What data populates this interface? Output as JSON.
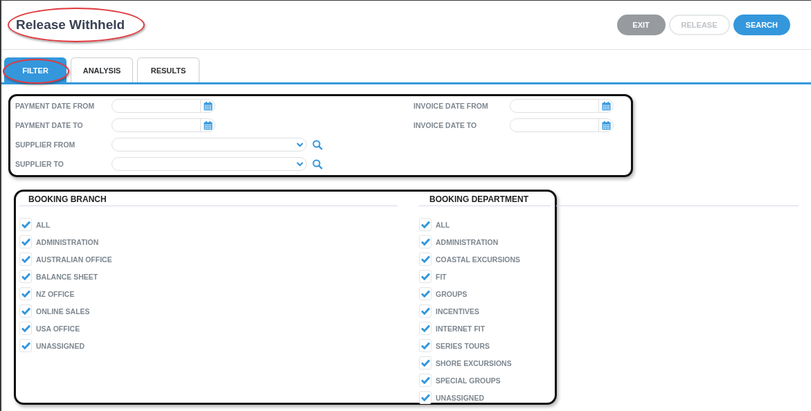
{
  "window": {
    "title": "Release Withheld"
  },
  "actions": [
    {
      "label": "EXIT",
      "kind": "secondary",
      "disabled": false
    },
    {
      "label": "RELEASE",
      "kind": "outline",
      "disabled": true
    },
    {
      "label": "SEARCH",
      "kind": "primary",
      "disabled": false
    }
  ],
  "tabs": [
    {
      "label": "FILTER",
      "selected": true
    },
    {
      "label": "ANALYSIS",
      "selected": false
    },
    {
      "label": "RESULTS",
      "selected": false
    }
  ],
  "filters_left": [
    {
      "label": "PAYMENT DATE FROM",
      "kind": "date"
    },
    {
      "label": "PAYMENT DATE TO",
      "kind": "date"
    },
    {
      "label": "SUPPLIER FROM",
      "kind": "select"
    },
    {
      "label": "SUPPLIER TO",
      "kind": "select"
    }
  ],
  "filters_right": [
    {
      "label": "INVOICE DATE FROM",
      "kind": "date"
    },
    {
      "label": "INVOICE DATE TO",
      "kind": "date"
    }
  ],
  "booking_branch": {
    "title": "BOOKING BRANCH",
    "items": [
      {
        "label": "ALL",
        "checked": true
      },
      {
        "label": "ADMINISTRATION",
        "checked": true
      },
      {
        "label": "AUSTRALIAN OFFICE",
        "checked": true
      },
      {
        "label": "BALANCE SHEET",
        "checked": true
      },
      {
        "label": "NZ OFFICE",
        "checked": true
      },
      {
        "label": "ONLINE SALES",
        "checked": true
      },
      {
        "label": "USA OFFICE",
        "checked": true
      },
      {
        "label": "UNASSIGNED",
        "checked": true
      }
    ]
  },
  "booking_department": {
    "title": "BOOKING DEPARTMENT",
    "items": [
      {
        "label": "ALL",
        "checked": true
      },
      {
        "label": "ADMINISTRATION",
        "checked": true
      },
      {
        "label": "COASTAL EXCURSIONS",
        "checked": true
      },
      {
        "label": "FIT",
        "checked": true
      },
      {
        "label": "GROUPS",
        "checked": true
      },
      {
        "label": "INCENTIVES",
        "checked": true
      },
      {
        "label": "INTERNET FIT",
        "checked": true
      },
      {
        "label": "SERIES TOURS",
        "checked": true
      },
      {
        "label": "SHORE EXCURSIONS",
        "checked": true
      },
      {
        "label": "SPECIAL GROUPS",
        "checked": true
      },
      {
        "label": "UNASSIGNED",
        "checked": true
      }
    ]
  }
}
